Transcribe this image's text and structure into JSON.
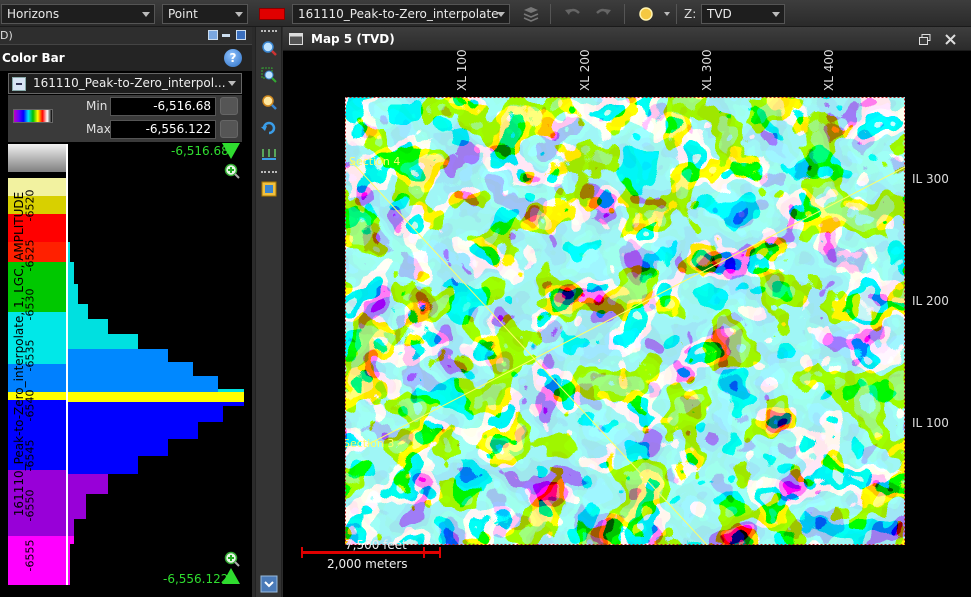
{
  "toolbar": {
    "layer_type": "Horizons",
    "symbol_type": "Point",
    "color_swatch": "#e00000",
    "horizon_name": "161110_Peak-to-Zero_interpolate",
    "z_label": "Z:",
    "z_domain": "TVD"
  },
  "left_panel": {
    "header_text": "D)",
    "title": "Color Bar",
    "help_label": "?",
    "attribute": "161110_Peak-to-Zero_interpol...",
    "min_label": "Min",
    "min_value": "-6,516.68",
    "max_label": "Max",
    "max_value": "-6,556.122",
    "top_value": "-6,516.68",
    "bottom_value": "-6,556.122",
    "axis_title": "161110_Peak-to-Zero_interpolate, 1, LGC, AMPLITUDE",
    "ticks": [
      "-6520",
      "-6525",
      "-6530",
      "-6535",
      "-6540",
      "-6545",
      "-6550",
      "-6555"
    ]
  },
  "map": {
    "title": "Map 5 (TVD)",
    "xl_labels": [
      "XL 100",
      "XL 200",
      "XL 300",
      "XL 400"
    ],
    "il_labels": [
      "IL 300",
      "IL 200",
      "IL 100"
    ],
    "section_labels": [
      "Section 4",
      "Section 3"
    ],
    "scale_feet": "7,500 feet",
    "scale_meters": "2,000 meters"
  },
  "colors": {
    "accent_green": "#2fdc2f",
    "section_line": "#ffff66",
    "scale_red": "#e00000"
  }
}
